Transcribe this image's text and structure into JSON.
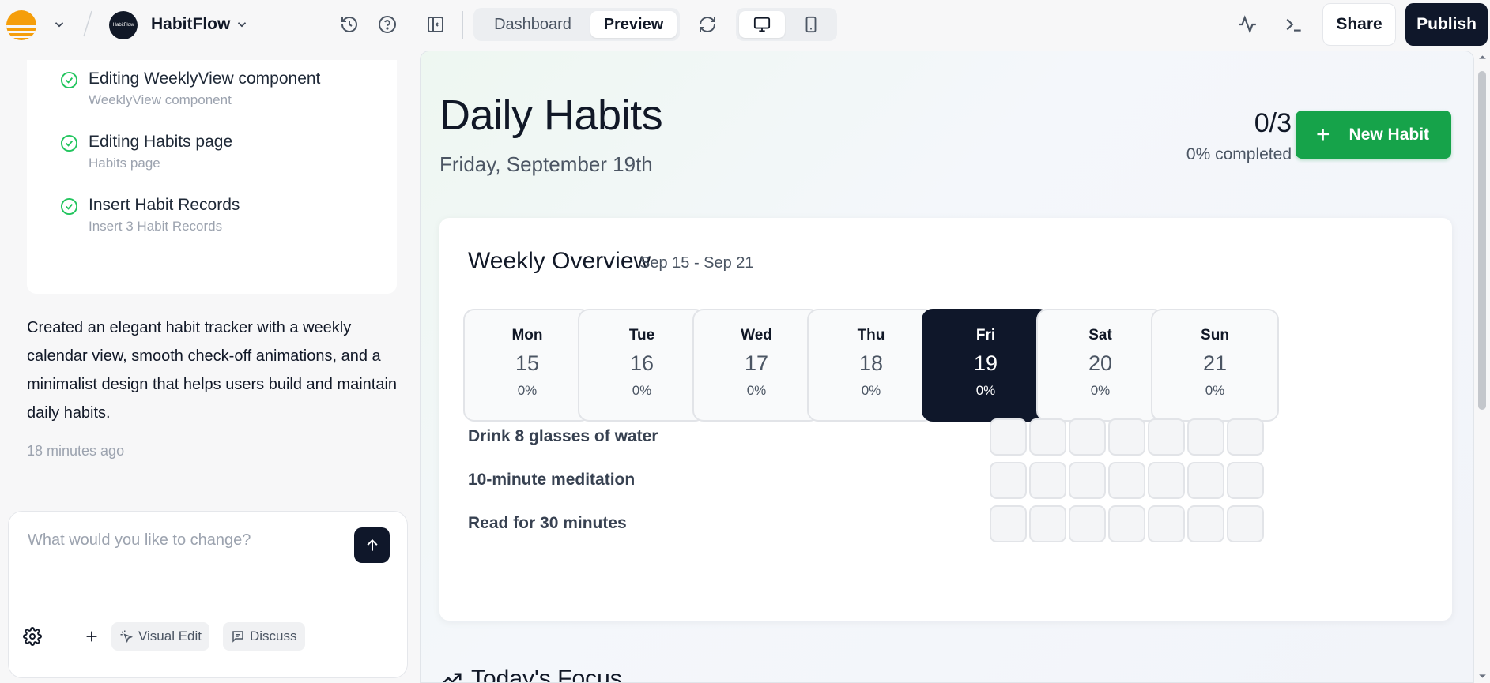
{
  "topbar": {
    "project_avatar_text": "HabitFlow",
    "project_name": "HabitFlow",
    "tabs": [
      {
        "label": "Dashboard",
        "active": false
      },
      {
        "label": "Preview",
        "active": true
      }
    ],
    "device_active": "desktop",
    "share_label": "Share",
    "publish_label": "Publish"
  },
  "chat": {
    "steps": [
      {
        "title": "Editing WeeklyView component",
        "sub": "WeeklyView component"
      },
      {
        "title": "Editing Habits page",
        "sub": "Habits page"
      },
      {
        "title": "Insert Habit Records",
        "sub": "Insert 3 Habit Records"
      }
    ],
    "message": "Created an elegant habit tracker with a weekly calendar view, smooth check-off animations, and a minimalist design that helps users build and maintain daily habits.",
    "timestamp": "18 minutes ago",
    "composer": {
      "placeholder": "What would you like to change?",
      "visual_edit_label": "Visual Edit",
      "discuss_label": "Discuss"
    }
  },
  "preview": {
    "title": "Daily Habits",
    "date": "Friday, September 19th",
    "completion_count": "0/3",
    "completion_pct": "0% completed",
    "new_habit_label": "New Habit",
    "weekly": {
      "title": "Weekly Overview",
      "range": "Sep 15 - Sep 21",
      "days": [
        {
          "name": "Mon",
          "num": "15",
          "pct": "0%",
          "today": false
        },
        {
          "name": "Tue",
          "num": "16",
          "pct": "0%",
          "today": false
        },
        {
          "name": "Wed",
          "num": "17",
          "pct": "0%",
          "today": false
        },
        {
          "name": "Thu",
          "num": "18",
          "pct": "0%",
          "today": false
        },
        {
          "name": "Fri",
          "num": "19",
          "pct": "0%",
          "today": true
        },
        {
          "name": "Sat",
          "num": "20",
          "pct": "0%",
          "today": false
        },
        {
          "name": "Sun",
          "num": "21",
          "pct": "0%",
          "today": false
        }
      ],
      "habits": [
        {
          "name": "Drink 8 glasses of water",
          "checked": [
            false,
            false,
            false,
            false,
            false,
            false,
            false
          ]
        },
        {
          "name": "10-minute meditation",
          "checked": [
            false,
            false,
            false,
            false,
            false,
            false,
            false
          ]
        },
        {
          "name": "Read for 30 minutes",
          "checked": [
            false,
            false,
            false,
            false,
            false,
            false,
            false
          ]
        }
      ]
    },
    "focus_title": "Today's Focus"
  },
  "colors": {
    "accent_green": "#16a34a",
    "dark": "#0f172a",
    "check_green": "#22c55e"
  },
  "icons": [
    "app-logo-icon",
    "chevron-down-icon",
    "history-icon",
    "help-icon",
    "sidebar-toggle-icon",
    "refresh-icon",
    "desktop-icon",
    "mobile-icon",
    "activity-icon",
    "terminal-icon",
    "check-circle-icon",
    "arrow-up-icon",
    "settings-icon",
    "plus-icon",
    "cursor-click-icon",
    "chat-icon",
    "trending-up-icon"
  ]
}
